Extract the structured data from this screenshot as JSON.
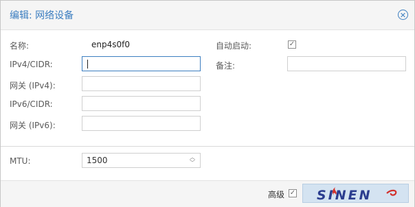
{
  "dialog": {
    "title": "编辑: 网络设备",
    "close_icon": "close-circle-icon"
  },
  "form": {
    "name_label": "名称:",
    "name_value": "enp4s0f0",
    "ipv4_label": "IPv4/CIDR:",
    "ipv4_value": "",
    "gateway4_label": "网关 (IPv4):",
    "gateway4_value": "",
    "ipv6_label": "IPv6/CIDR:",
    "ipv6_value": "",
    "gateway6_label": "网关 (IPv6):",
    "gateway6_value": "",
    "autostart_label": "自动启动:",
    "autostart_checked": true,
    "comment_label": "备注:",
    "comment_value": "",
    "mtu_label": "MTU:",
    "mtu_value": "1500"
  },
  "footer": {
    "advanced_label": "高级",
    "advanced_checked": true,
    "watermark_text": "SINEN"
  },
  "colors": {
    "accent": "#3c7ec0",
    "watermark_text": "#2b3d8f",
    "watermark_flame": "#d2322d"
  }
}
